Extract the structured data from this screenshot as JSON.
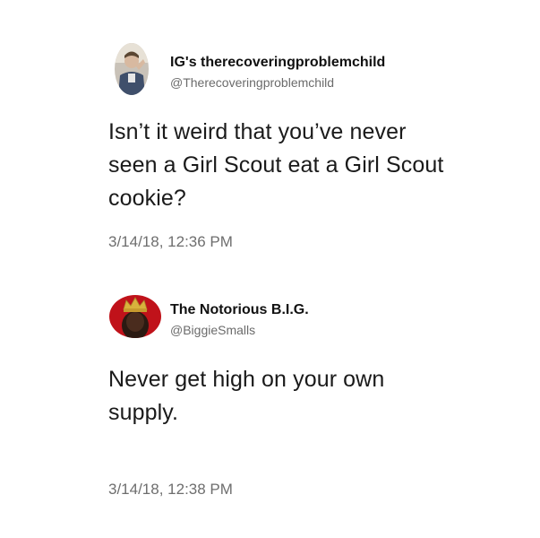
{
  "tweets": [
    {
      "display_name": "IG's therecoveringproblemchild",
      "handle": "@Therecoveringproblemchild",
      "avatar_icon": "profile-photo-man-icon",
      "text_lines": [
        "Isn’t it weird that you’ve never",
        "seen a Girl Scout eat a Girl Scout",
        "cookie?"
      ],
      "timestamp": "3/14/18, 12:36 PM"
    },
    {
      "display_name": "The Notorious B.I.G.",
      "handle": "@BiggieSmalls",
      "avatar_icon": "profile-photo-crown-icon",
      "text_lines": [
        "Never get high on your own",
        "supply."
      ],
      "timestamp": "3/14/18, 12:38 PM"
    }
  ],
  "colors": {
    "background": "#ffffff",
    "name": "#111111",
    "handle": "#6b6b6b",
    "body": "#1a1a1a",
    "timestamp": "#6e6e6e",
    "avatar2_bg": "#c0121a"
  }
}
